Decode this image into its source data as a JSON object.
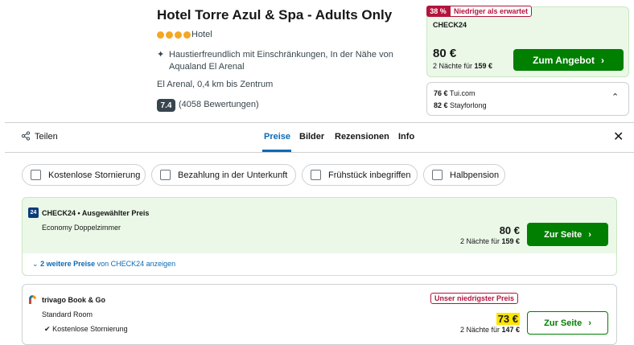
{
  "hotel": {
    "name": "Hotel Torre Azul & Spa - Adults Only",
    "stars": 4,
    "type": "Hotel",
    "features": "Haustierfreundlich mit Einschränkungen, In der Nähe von Aqualand El Arenal",
    "location": "El Arenal, 0,4 km bis Zentrum",
    "rating": "7.4",
    "reviews": "(4058 Bewertungen)"
  },
  "deal": {
    "discount": "38 %",
    "badge": "Niedriger als erwartet",
    "provider": "CHECK24",
    "price": "80 €",
    "nights_prefix": "2 Nächte für ",
    "nights_total": "159 €",
    "button": "Zum Angebot"
  },
  "alternatives": [
    {
      "price": "76 €",
      "provider": "Tui.com"
    },
    {
      "price": "82 €",
      "provider": "Stayforlong"
    }
  ],
  "tabs": {
    "share": "Teilen",
    "items": [
      "Preise",
      "Bilder",
      "Rezensionen",
      "Info"
    ]
  },
  "filters": [
    "Kostenlose Stornierung",
    "Bezahlung in der Unterkunft",
    "Frühstück inbegriffen",
    "Halbpension"
  ],
  "offers": [
    {
      "provider": "CHECK24 • Ausgewählter Preis",
      "room": "Economy Doppelzimmer",
      "price": "80 €",
      "nights_prefix": "2 Nächte für ",
      "nights_total": "159 €",
      "button": "Zur Seite",
      "more_bold": "2 weitere Preise",
      "more_rest": " von CHECK24 anzeigen"
    },
    {
      "provider": "trivago Book & Go",
      "room": "Standard Room",
      "badge": "Unser niedrigster Preis",
      "cancel": "Kostenlose Stornierung",
      "price": "73 €",
      "nights_prefix": "2 Nächte für ",
      "nights_total": "147 €",
      "button": "Zur Seite"
    }
  ],
  "colors": {
    "accent_green": "#007f00",
    "deal_bg": "#ebf8e8",
    "badge_red": "#b3143c",
    "link_blue": "#0a6ab6",
    "highlight": "#ffe500"
  }
}
